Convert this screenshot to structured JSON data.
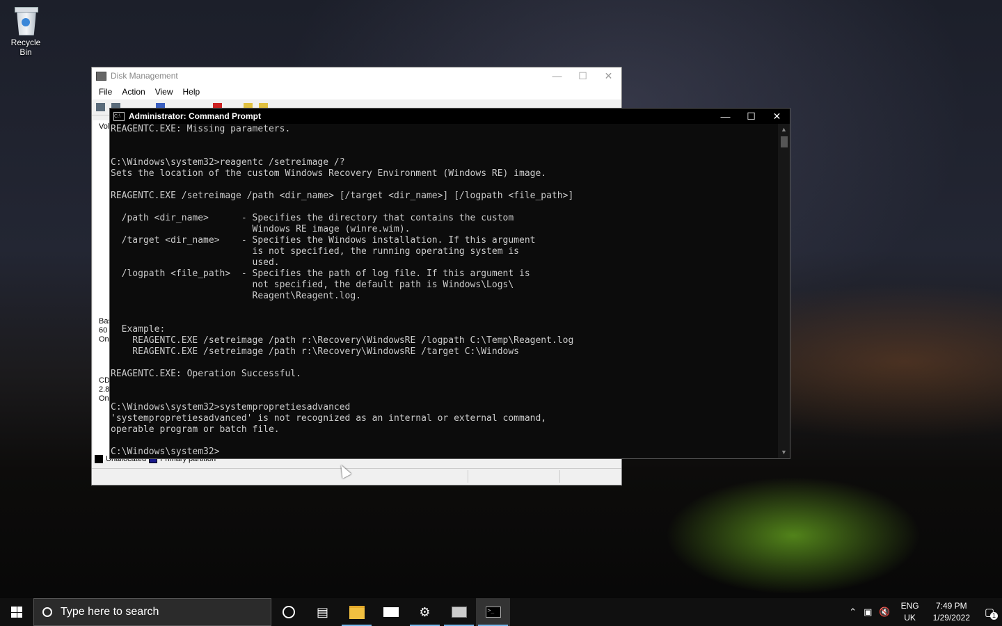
{
  "desktop": {
    "icons": [
      {
        "label": "Recycle Bin",
        "icon": "recycle-bin-icon"
      }
    ]
  },
  "disk_management": {
    "title": "Disk Management",
    "menu": [
      "File",
      "Action",
      "View",
      "Help"
    ],
    "left_column": {
      "header": "Vol",
      "disk0": [
        "Bas",
        "60",
        "Onl"
      ],
      "cdrom": [
        "CD",
        "2.8",
        "Onl"
      ]
    },
    "legend": [
      {
        "label": "Unallocated",
        "color": "#000000"
      },
      {
        "label": "Primary partition",
        "color": "#1a1a8c"
      }
    ]
  },
  "cmd": {
    "title": "Administrator: Command Prompt",
    "lines": [
      "REAGENTC.EXE: Missing parameters.",
      "",
      "",
      "C:\\Windows\\system32>reagentc /setreimage /?",
      "Sets the location of the custom Windows Recovery Environment (Windows RE) image.",
      "",
      "REAGENTC.EXE /setreimage /path <dir_name> [/target <dir_name>] [/logpath <file_path>]",
      "",
      "  /path <dir_name>      - Specifies the directory that contains the custom",
      "                          Windows RE image (winre.wim).",
      "  /target <dir_name>    - Specifies the Windows installation. If this argument",
      "                          is not specified, the running operating system is",
      "                          used.",
      "  /logpath <file_path>  - Specifies the path of log file. If this argument is",
      "                          not specified, the default path is Windows\\Logs\\",
      "                          Reagent\\Reagent.log.",
      "",
      "",
      "  Example:",
      "    REAGENTC.EXE /setreimage /path r:\\Recovery\\WindowsRE /logpath C:\\Temp\\Reagent.log",
      "    REAGENTC.EXE /setreimage /path r:\\Recovery\\WindowsRE /target C:\\Windows",
      "",
      "REAGENTC.EXE: Operation Successful.",
      "",
      "",
      "C:\\Windows\\system32>systempropretiesadvanced",
      "'systempropretiesadvanced' is not recognized as an internal or external command,",
      "operable program or batch file.",
      "",
      "C:\\Windows\\system32>"
    ],
    "prompt": "C:\\Windows\\system32>"
  },
  "taskbar": {
    "search_placeholder": "Type here to search",
    "apps": [
      "cortana-icon",
      "task-view-icon",
      "file-explorer-icon",
      "mail-icon",
      "settings-icon",
      "disk-management-icon",
      "command-prompt-icon"
    ],
    "language": {
      "line1": "ENG",
      "line2": "UK"
    },
    "time": "7:49 PM",
    "date": "1/29/2022",
    "notification_count": "1"
  }
}
